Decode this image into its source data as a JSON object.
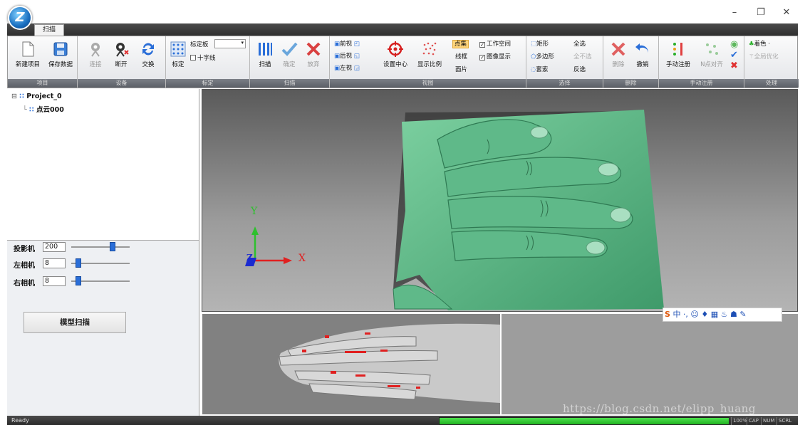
{
  "window": {
    "minimize": "–",
    "restore": "❐",
    "close": "✕"
  },
  "ribbon": {
    "active_tab": "扫描",
    "groups": {
      "project": {
        "caption": "项目",
        "new_project": "新建项目",
        "save_data": "保存数据"
      },
      "device": {
        "caption": "设备",
        "connect": "连接",
        "disconnect": "断开",
        "swap": "交换"
      },
      "calibration": {
        "caption": "标定",
        "calibrate": "标定",
        "board_label": "标定板",
        "crosshair": "十字线"
      },
      "scan": {
        "caption": "扫描",
        "scan": "扫描",
        "confirm": "确定",
        "discard": "放弃"
      },
      "view": {
        "caption": "视图",
        "front": "前视",
        "back": "后视",
        "left": "左视",
        "set_center": "设置中心",
        "display_ratio": "显示比例",
        "point_set": "点集",
        "wireframe": "线框",
        "patch": "面片",
        "workspace": "工作空间",
        "image_display": "图像显示"
      },
      "select": {
        "caption": "选择",
        "rect": "矩形",
        "polygon": "多边形",
        "magic": "套索",
        "all": "全选",
        "none": "全不选",
        "invert": "反选"
      },
      "delete": {
        "caption": "删除",
        "delete": "删除",
        "undo": "撤销"
      },
      "manual_reg": {
        "caption": "手动注册",
        "manual": "手动注册",
        "n_align": "N点对齐"
      },
      "process": {
        "caption": "处理",
        "color": "着色 ·",
        "global_opt": "全局优化"
      }
    }
  },
  "tree": {
    "project": "Project_0",
    "cloud": "点云000"
  },
  "controls": {
    "projector": {
      "label": "投影机",
      "value": "200",
      "level": 0.73
    },
    "left_cam": {
      "label": "左相机",
      "value": "8",
      "level": 0.08
    },
    "right_cam": {
      "label": "右相机",
      "value": "8",
      "level": 0.08
    },
    "scan_button": "模型扫描"
  },
  "viewport": {
    "axis_y": "Y",
    "axis_x": "X",
    "axis_z": "Z"
  },
  "ime": {
    "brand": "S",
    "items": "中 ·, ☺ ♦ ▦ ♨ ☗ ✎"
  },
  "status": {
    "text": "Ready",
    "progress": 1.0,
    "indicators": [
      "100%",
      "CAP",
      "NUM",
      "SCRL"
    ]
  },
  "watermark": "https://blog.csdn.net/elipp_huang",
  "colors": {
    "mesh": "#62b98a",
    "accent": "#2a6ed8",
    "error": "#e03030"
  }
}
